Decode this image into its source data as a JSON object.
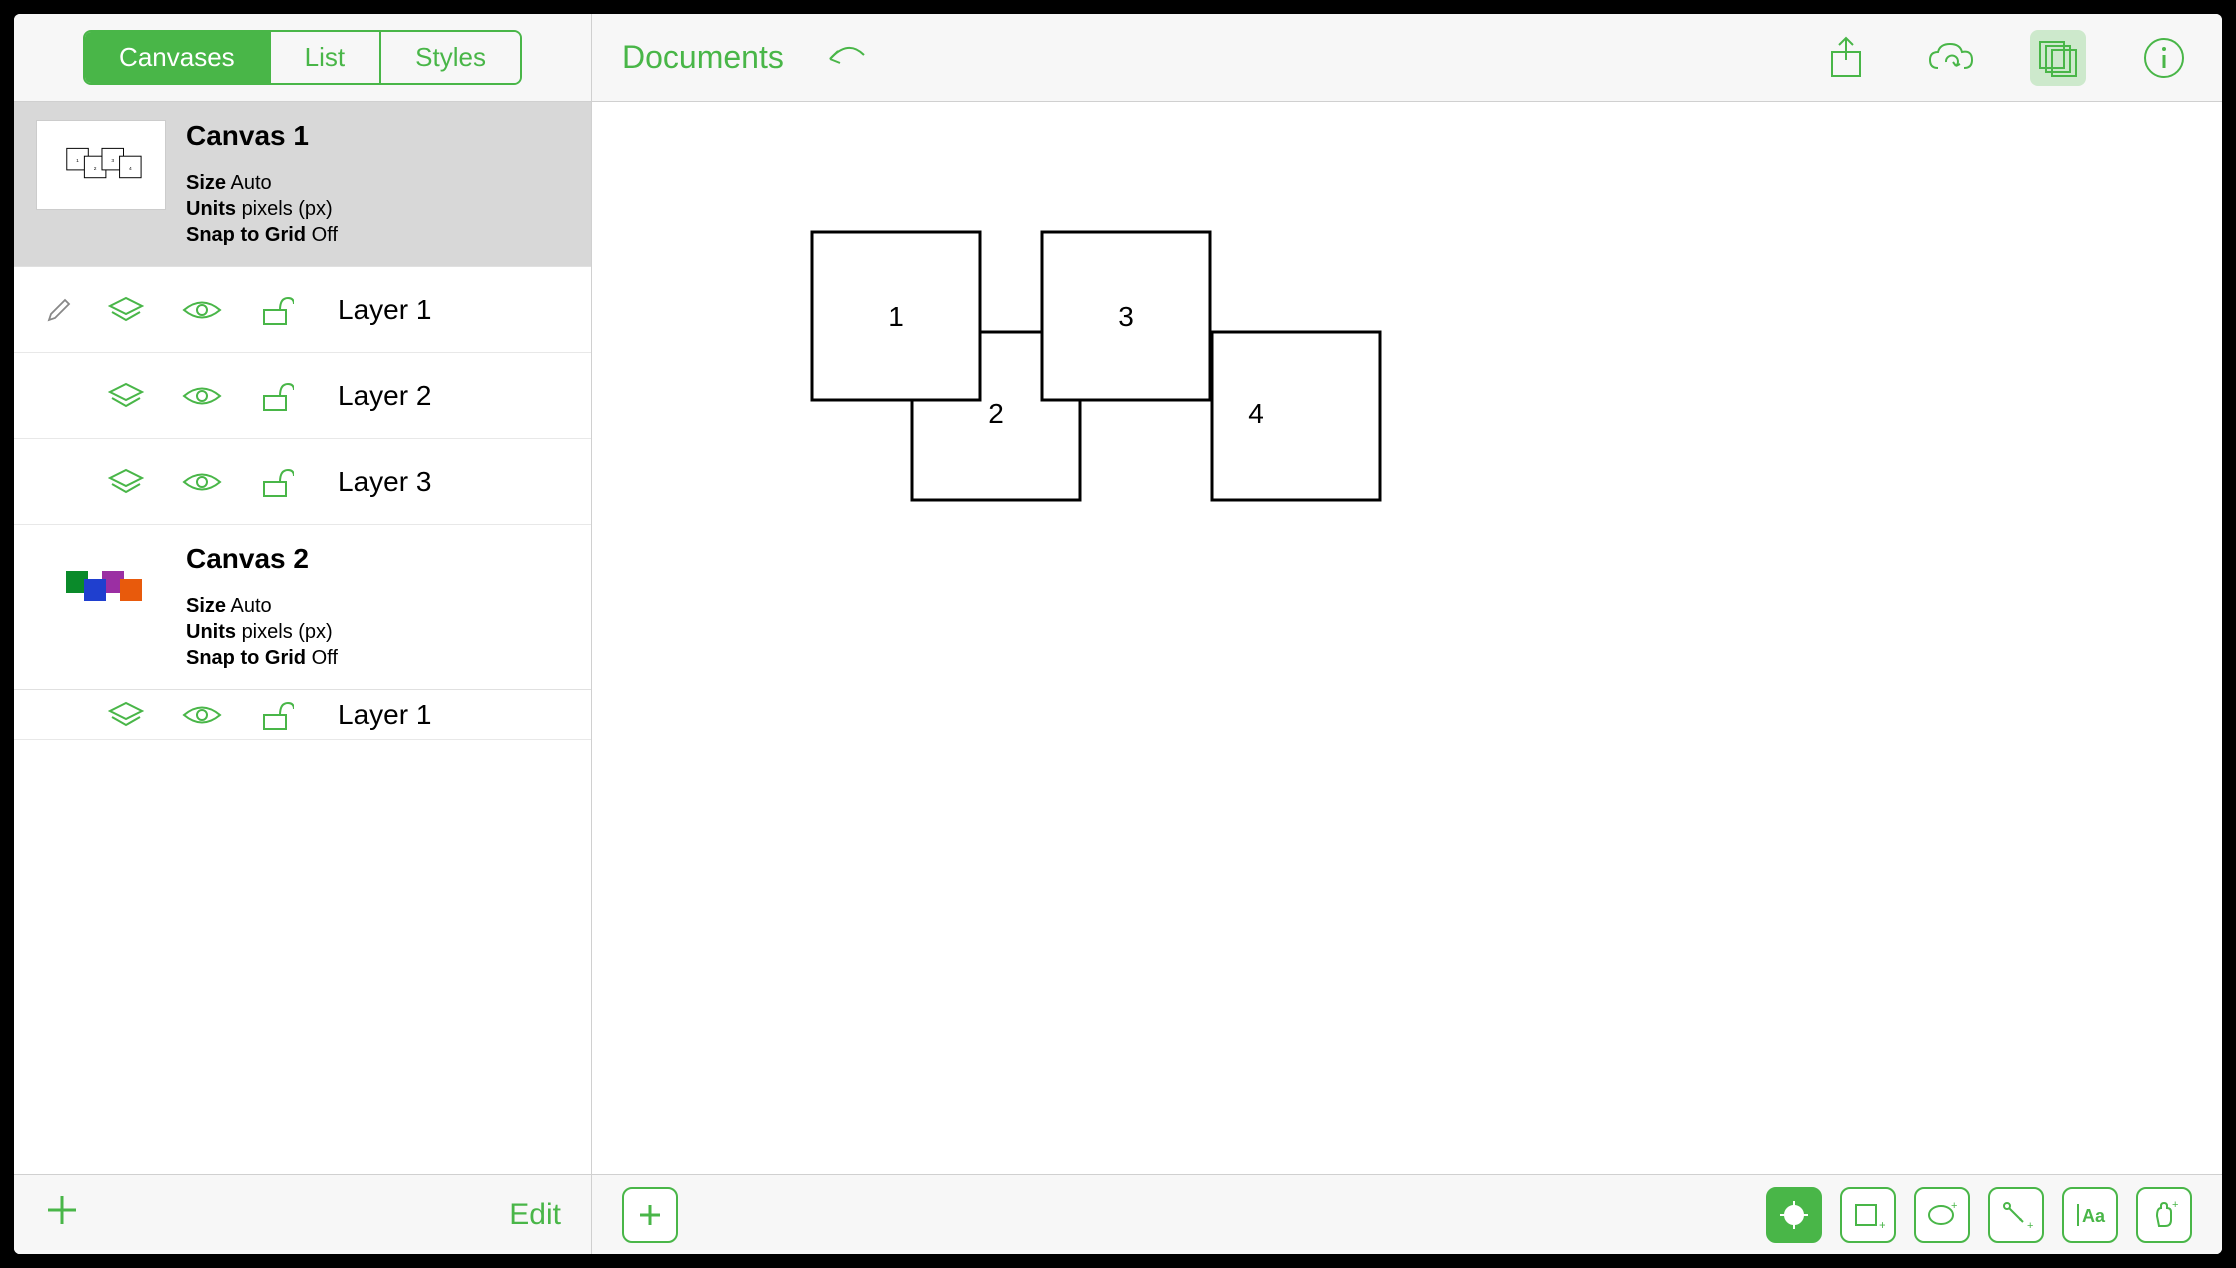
{
  "tabs": {
    "canvases": "Canvases",
    "list": "List",
    "styles": "Styles",
    "active": "canvases"
  },
  "header": {
    "documents": "Documents"
  },
  "sidebar": {
    "edit": "Edit",
    "canvases": [
      {
        "title": "Canvas 1",
        "size_label": "Size",
        "size_value": "Auto",
        "units_label": "Units",
        "units_value": "pixels (px)",
        "snap_label": "Snap to Grid",
        "snap_value": "Off",
        "selected": true,
        "thumb_style": "outline",
        "layers": [
          {
            "name": "Layer 1",
            "editing": true
          },
          {
            "name": "Layer 2",
            "editing": false
          },
          {
            "name": "Layer 3",
            "editing": false
          }
        ]
      },
      {
        "title": "Canvas 2",
        "size_label": "Size",
        "size_value": "Auto",
        "units_label": "Units",
        "units_value": "pixels (px)",
        "snap_label": "Snap to Grid",
        "snap_value": "Off",
        "selected": false,
        "thumb_style": "colored",
        "layers": [
          {
            "name": "Layer 1",
            "editing": false
          }
        ]
      }
    ]
  },
  "main_canvas": {
    "squares": [
      {
        "label": "1"
      },
      {
        "label": "2"
      },
      {
        "label": "3"
      },
      {
        "label": "4"
      }
    ]
  },
  "colors": {
    "accent": "#49b648"
  }
}
